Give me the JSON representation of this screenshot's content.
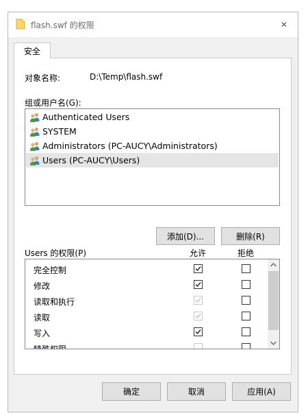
{
  "window": {
    "title": "flash.swf 的权限",
    "close_label": "✕"
  },
  "tabs": [
    {
      "label": "安全"
    }
  ],
  "security": {
    "object_name_label": "对象名称:",
    "object_name_value": "D:\\Temp\\flash.swf",
    "groups_label": "组或用户名(G):",
    "users": [
      {
        "label": "Authenticated Users",
        "selected": false
      },
      {
        "label": "SYSTEM",
        "selected": false
      },
      {
        "label": "Administrators (PC-AUCY\\Administrators)",
        "selected": false
      },
      {
        "label": "Users (PC-AUCY\\Users)",
        "selected": true
      }
    ],
    "add_button": "添加(D)...",
    "remove_button": "删除(R)",
    "permissions_label": "Users 的权限(P)",
    "allow_header": "允许",
    "deny_header": "拒绝",
    "permissions": [
      {
        "name": "完全控制",
        "allow": true,
        "allow_disabled": false,
        "deny": false
      },
      {
        "name": "修改",
        "allow": true,
        "allow_disabled": false,
        "deny": false
      },
      {
        "name": "读取和执行",
        "allow": true,
        "allow_disabled": true,
        "deny": false
      },
      {
        "name": "读取",
        "allow": true,
        "allow_disabled": true,
        "deny": false
      },
      {
        "name": "写入",
        "allow": true,
        "allow_disabled": false,
        "deny": false
      },
      {
        "name": "特殊权限",
        "allow": false,
        "allow_disabled": true,
        "deny": false
      }
    ]
  },
  "footer": {
    "ok": "确定",
    "cancel": "取消",
    "apply": "应用(A)"
  }
}
